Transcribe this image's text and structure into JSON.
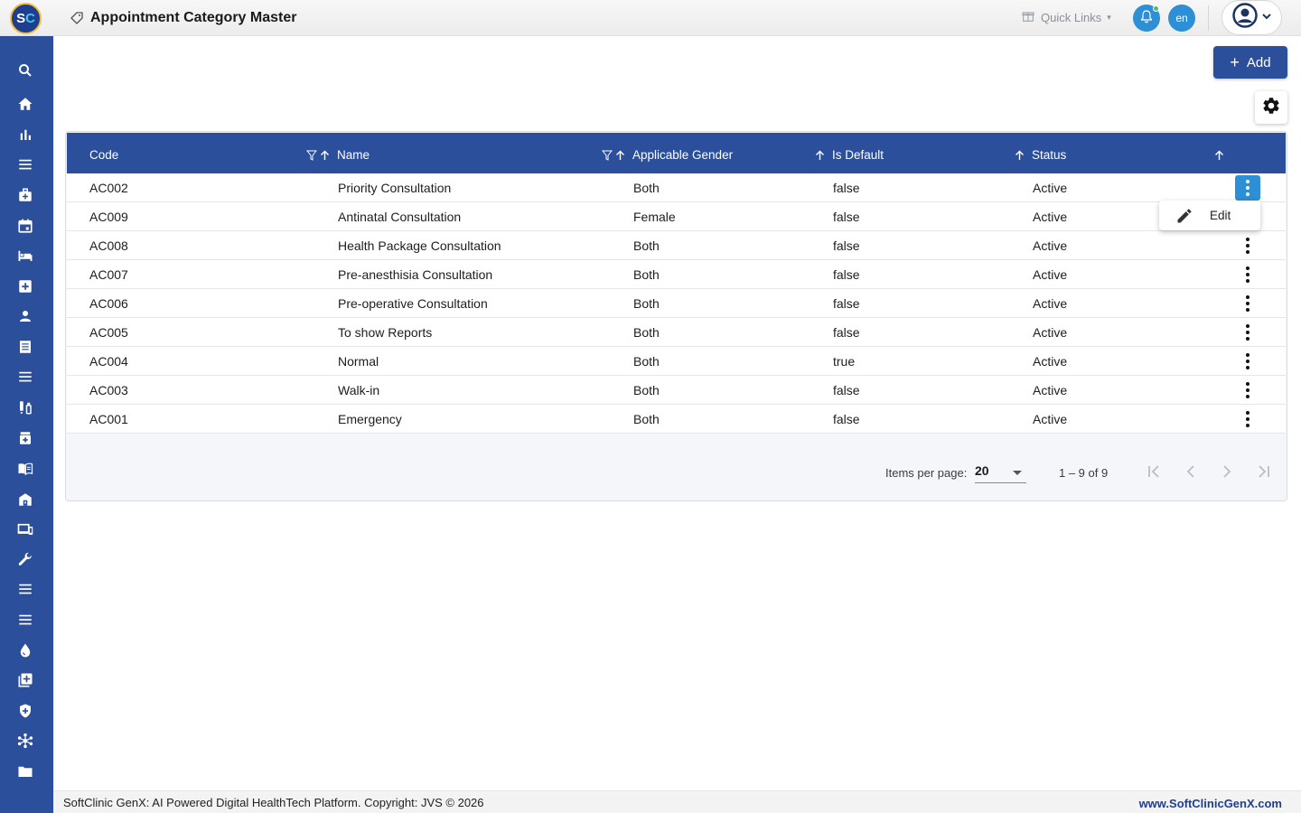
{
  "app": {
    "logo_text_s": "S",
    "logo_text_c": "C",
    "page_title": "Appointment Category Master"
  },
  "header": {
    "quick_links_label": "Quick Links",
    "lang_label": "en",
    "colors": {
      "accent": "#2d8fd5",
      "primary": "#2b4f9b",
      "status_dot": "#3ec46d"
    }
  },
  "sidebar": {
    "items": [
      {
        "icon": "search-icon"
      },
      {
        "icon": "home-icon"
      },
      {
        "icon": "bar-chart-icon"
      },
      {
        "icon": "menu-icon"
      },
      {
        "icon": "medical-bag-icon"
      },
      {
        "icon": "calendar-icon"
      },
      {
        "icon": "bed-icon"
      },
      {
        "icon": "plus-box-icon"
      },
      {
        "icon": "person-icon"
      },
      {
        "icon": "document-icon"
      },
      {
        "icon": "menu-icon"
      },
      {
        "icon": "lab-test-icon"
      },
      {
        "icon": "medicine-icon"
      },
      {
        "icon": "book-icon"
      },
      {
        "icon": "building-icon"
      },
      {
        "icon": "devices-icon"
      },
      {
        "icon": "wrench-icon"
      },
      {
        "icon": "menu-icon"
      },
      {
        "icon": "menu-icon"
      },
      {
        "icon": "drop-icon"
      },
      {
        "icon": "library-add-icon"
      },
      {
        "icon": "shield-icon"
      },
      {
        "icon": "hub-icon"
      },
      {
        "icon": "folder-icon"
      }
    ]
  },
  "toolbar": {
    "add_label": "Add"
  },
  "table": {
    "columns": [
      "Code",
      "Name",
      "Applicable Gender",
      "Is Default",
      "Status"
    ],
    "rows": [
      {
        "code": "AC002",
        "name": "Priority Consultation",
        "gender": "Both",
        "is_default": "false",
        "status": "Active"
      },
      {
        "code": "AC009",
        "name": "Antinatal Consultation",
        "gender": "Female",
        "is_default": "false",
        "status": "Active"
      },
      {
        "code": "AC008",
        "name": "Health Package Consultation",
        "gender": "Both",
        "is_default": "false",
        "status": "Active"
      },
      {
        "code": "AC007",
        "name": "Pre-anesthisia Consultation",
        "gender": "Both",
        "is_default": "false",
        "status": "Active"
      },
      {
        "code": "AC006",
        "name": "Pre-operative Consultation",
        "gender": "Both",
        "is_default": "false",
        "status": "Active"
      },
      {
        "code": "AC005",
        "name": "To show Reports",
        "gender": "Both",
        "is_default": "false",
        "status": "Active"
      },
      {
        "code": "AC004",
        "name": "Normal",
        "gender": "Both",
        "is_default": "true",
        "status": "Active"
      },
      {
        "code": "AC003",
        "name": "Walk-in",
        "gender": "Both",
        "is_default": "false",
        "status": "Active"
      },
      {
        "code": "AC001",
        "name": "Emergency",
        "gender": "Both",
        "is_default": "false",
        "status": "Active"
      }
    ]
  },
  "row_menu": {
    "edit_label": "Edit"
  },
  "paginator": {
    "items_per_page_label": "Items per page:",
    "items_per_page_value": "20",
    "range_label": "1 – 9 of 9"
  },
  "footer": {
    "copyright": "SoftClinic GenX: AI Powered Digital HealthTech Platform. Copyright: JVS © 2026",
    "website": "www.SoftClinicGenX.com"
  }
}
